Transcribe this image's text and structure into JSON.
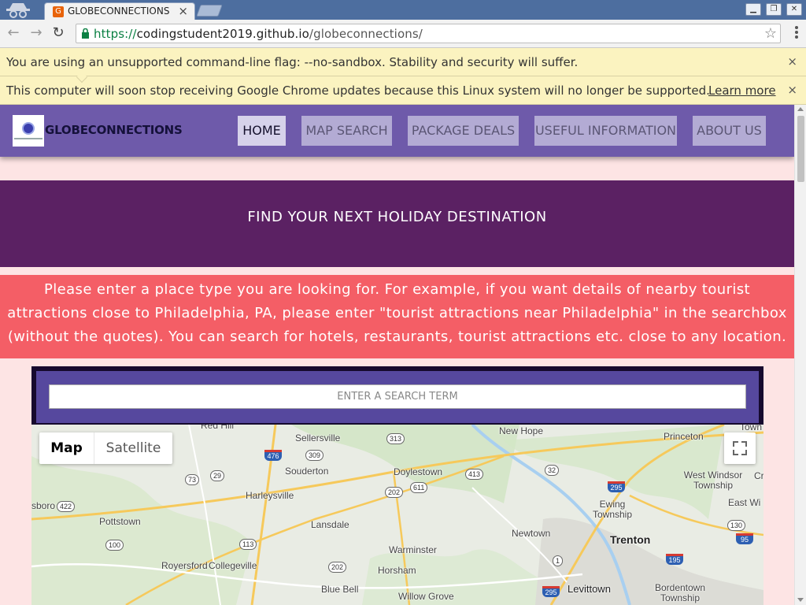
{
  "browser": {
    "tab_title": "GLOBECONNECTIONS",
    "tab_favicon_letter": "G",
    "url_scheme": "https://",
    "url_host": "codingstudent2019.github.io",
    "url_path": "/globeconnections/",
    "close_glyph": "×",
    "infobar1_text": "You are using an unsupported command-line flag: --no-sandbox. Stability and security will suffer.",
    "infobar2_text": "This computer will soon stop receiving Google Chrome updates because this Linux system will no longer be supported.",
    "learn_more": "Learn more"
  },
  "site": {
    "brand": "GLOBECONNECTIONS",
    "nav": [
      {
        "label": "HOME",
        "active": true
      },
      {
        "label": "MAP SEARCH",
        "active": false
      },
      {
        "label": "PACKAGE DEALS",
        "active": false
      },
      {
        "label": "USEFUL INFORMATION",
        "active": false
      },
      {
        "label": "ABOUT US",
        "active": false
      }
    ],
    "hero_title": "FIND YOUR NEXT HOLIDAY DESTINATION",
    "notice": "Please enter a place type you are looking for. For example, if you want details of nearby tourist attractions close to Philadelphia, PA, please enter \"tourist attractions near Philadelphia\" in the searchbox (without the quotes). You can search for hotels, restaurants, tourist attractions etc. close to any location.",
    "search_placeholder": "ENTER A SEARCH TERM"
  },
  "map": {
    "type_buttons": [
      "Map",
      "Satellite"
    ],
    "places": [
      "Red Hill",
      "Sellersville",
      "New Hope",
      "Princeton",
      "Town",
      "Souderton",
      "Doylestown",
      "West Windsor Township",
      "Cr",
      "Harleysville",
      "Ewing Township",
      "East Wi",
      "sboro",
      "Pottstown",
      "Lansdale",
      "Newtown",
      "Trenton",
      "Warminster",
      "Royersford",
      "Collegeville",
      "Horsham",
      "Levittown",
      "Bordentown Township",
      "Blue Bell",
      "Willow Grove"
    ],
    "routes": [
      "313",
      "309",
      "476",
      "73",
      "29",
      "202",
      "611",
      "413",
      "32",
      "295",
      "422",
      "100",
      "113",
      "202",
      "1",
      "130",
      "95",
      "195",
      "295"
    ]
  },
  "colors": {
    "nav_bg": "#6e5aaa",
    "hero_bg": "#5b2163",
    "notice_bg": "#f45e66",
    "page_bg": "#fde4e4",
    "search_bg": "#56489e"
  }
}
